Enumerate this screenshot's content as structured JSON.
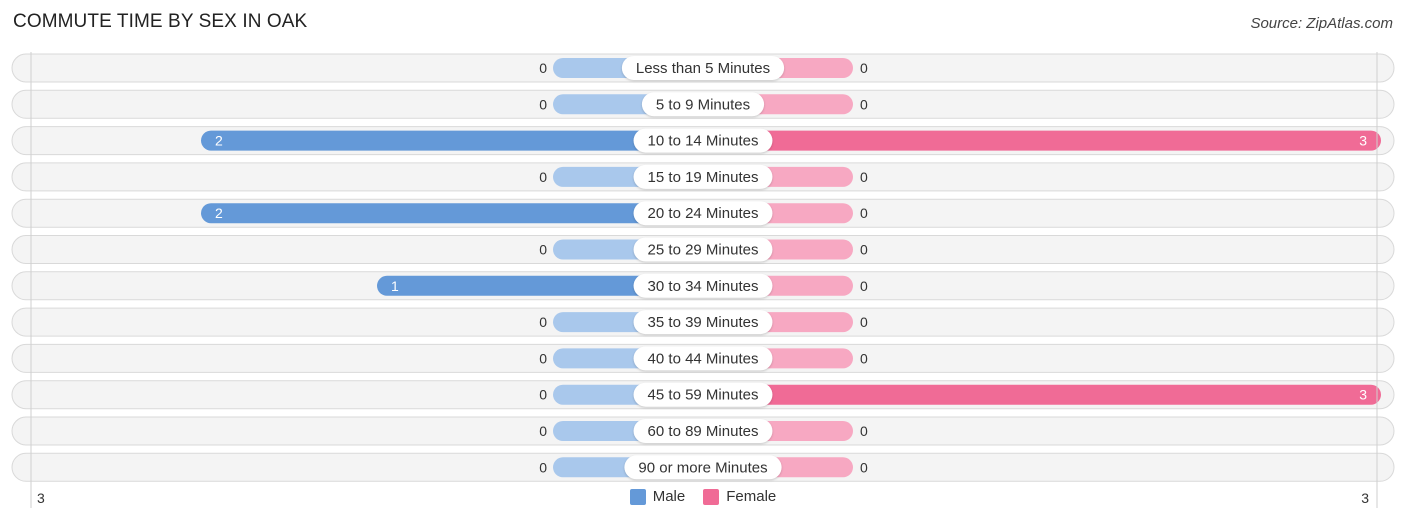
{
  "title": "COMMUTE TIME BY SEX IN OAK",
  "source": "Source: ZipAtlas.com",
  "colors": {
    "male_strong": "#6499d8",
    "male_light": "#a9c8ec",
    "female_strong": "#f06b96",
    "female_light": "#f7a8c2"
  },
  "legend": [
    {
      "label": "Male",
      "color": "#6499d8"
    },
    {
      "label": "Female",
      "color": "#f06b96"
    }
  ],
  "axis": {
    "left_label": "3",
    "right_label": "3"
  },
  "chart_data": {
    "type": "bar",
    "orientation": "horizontal-diverging",
    "title": "COMMUTE TIME BY SEX IN OAK",
    "categories": [
      "Less than 5 Minutes",
      "5 to 9 Minutes",
      "10 to 14 Minutes",
      "15 to 19 Minutes",
      "20 to 24 Minutes",
      "25 to 29 Minutes",
      "30 to 34 Minutes",
      "35 to 39 Minutes",
      "40 to 44 Minutes",
      "45 to 59 Minutes",
      "60 to 89 Minutes",
      "90 or more Minutes"
    ],
    "series": [
      {
        "name": "Male",
        "values": [
          0,
          0,
          2,
          0,
          2,
          0,
          1,
          0,
          0,
          0,
          0,
          0
        ]
      },
      {
        "name": "Female",
        "values": [
          0,
          0,
          3,
          0,
          0,
          0,
          0,
          0,
          0,
          3,
          0,
          0
        ]
      }
    ],
    "xlim": [
      -3,
      3
    ],
    "axis_tick_labels": [
      "3",
      "3"
    ],
    "legend_position": "bottom-center",
    "grid": false
  }
}
